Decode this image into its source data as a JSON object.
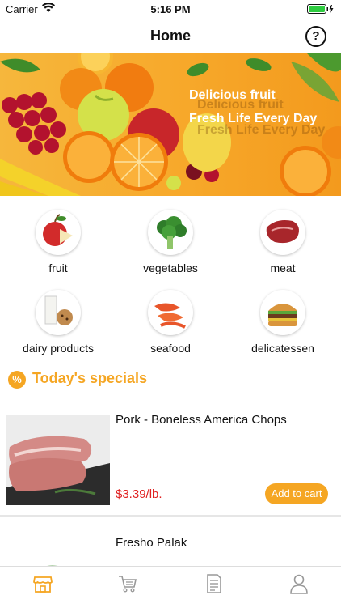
{
  "status": {
    "carrier": "Carrier",
    "time": "5:16 PM"
  },
  "nav": {
    "title": "Home",
    "help": "?"
  },
  "banner": {
    "line1": "Delicious fruit",
    "line2": "Fresh Life Every Day"
  },
  "categories": [
    {
      "label": "fruit"
    },
    {
      "label": "vegetables"
    },
    {
      "label": "meat"
    },
    {
      "label": "dairy products"
    },
    {
      "label": "seafood"
    },
    {
      "label": "delicatessen"
    }
  ],
  "specials": {
    "icon": "%",
    "title": "Today's specials"
  },
  "products": [
    {
      "title": "Pork - Boneless America Chops",
      "price": "$3.39/lb.",
      "button": "Add to cart"
    },
    {
      "title": "Fresho Palak"
    }
  ],
  "colors": {
    "accent": "#f5a623",
    "price": "#e02020"
  },
  "tabs": [
    {
      "icon": "store-icon",
      "active": true
    },
    {
      "icon": "cart-icon",
      "active": false
    },
    {
      "icon": "orders-icon",
      "active": false
    },
    {
      "icon": "profile-icon",
      "active": false
    }
  ]
}
